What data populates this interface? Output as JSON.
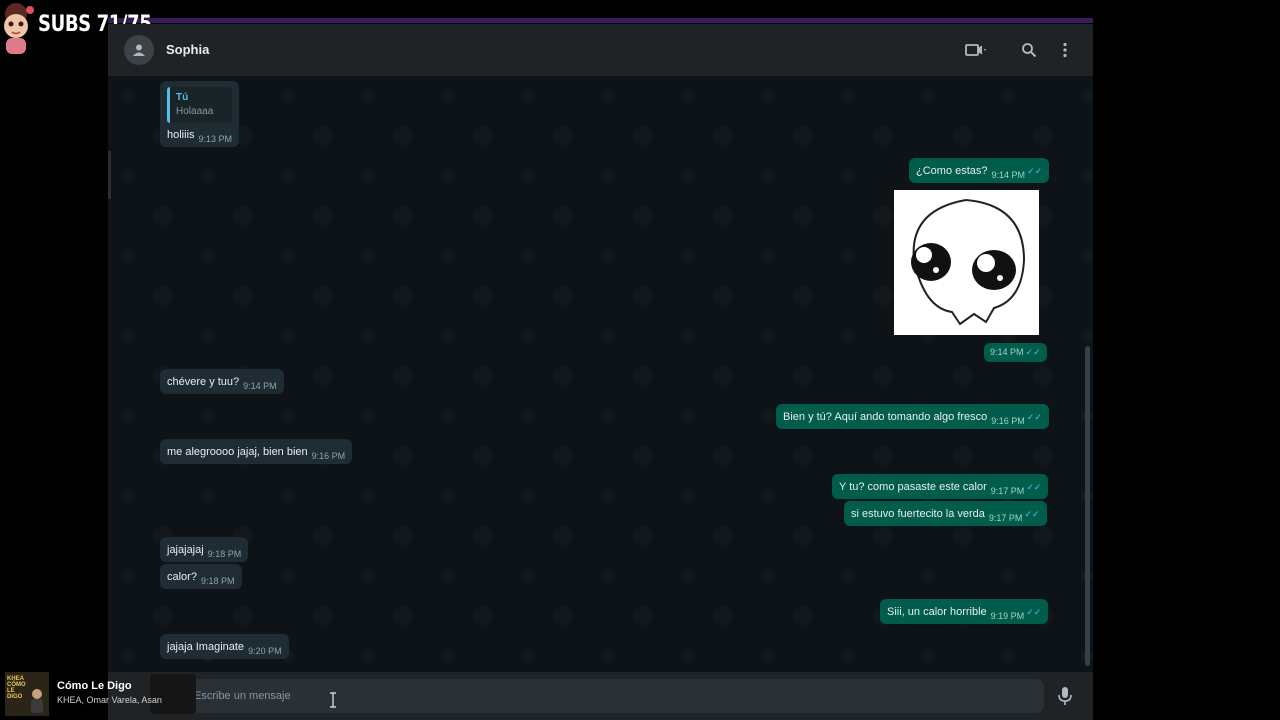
{
  "overlay": {
    "subs_label": "SUBS 71/75"
  },
  "header": {
    "contact_name": "Sophia",
    "icons": [
      "video-call-icon",
      "chevron-down-icon",
      "search-icon",
      "menu-dots-icon"
    ]
  },
  "messages": [
    {
      "dir": "in",
      "quote_author": "Tú",
      "quote_text": "Holaaaa",
      "text": "holiiis",
      "time": "9:13 PM"
    },
    {
      "dir": "out",
      "text": "¿Como estas?",
      "time": "9:14 PM",
      "ticks": "✓✓"
    },
    {
      "dir": "out",
      "sticker": "sticker-image",
      "time": "9:14 PM",
      "ticks": "✓✓"
    },
    {
      "dir": "in",
      "text": "chévere y tuu?",
      "time": "9:14 PM"
    },
    {
      "dir": "out",
      "text": "Bien y tú? Aquí ando tomando algo fresco",
      "time": "9:16 PM",
      "ticks": "✓✓"
    },
    {
      "dir": "in",
      "text": "me alegroooo jajaj, bien bien",
      "time": "9:16 PM"
    },
    {
      "dir": "out",
      "text": "Y tu? como pasaste este calor",
      "time": "9:17 PM",
      "ticks": "✓✓"
    },
    {
      "dir": "out",
      "text": "si estuvo fuertecito la verda",
      "time": "9:17 PM",
      "ticks": "✓✓"
    },
    {
      "dir": "in",
      "text": "jajajajaj",
      "time": "9:18 PM"
    },
    {
      "dir": "in",
      "text": "calor?",
      "time": "9:18 PM"
    },
    {
      "dir": "out",
      "text": "Siii, un calor horrible",
      "time": "9:19 PM",
      "ticks": "✓✓"
    },
    {
      "dir": "in",
      "text": "jajaja Imaginate",
      "time": "9:20 PM"
    }
  ],
  "composer": {
    "placeholder": "Escribe un mensaje"
  },
  "now_playing": {
    "album_text": "KHEA CÓMO LE DIGO",
    "title": "Cómo Le Digo",
    "artist": "KHEA, Omar Varela, Asan"
  },
  "colors": {
    "incoming": "#1f2c33",
    "outgoing": "#005c4b",
    "ticks": "#53bdeb"
  }
}
